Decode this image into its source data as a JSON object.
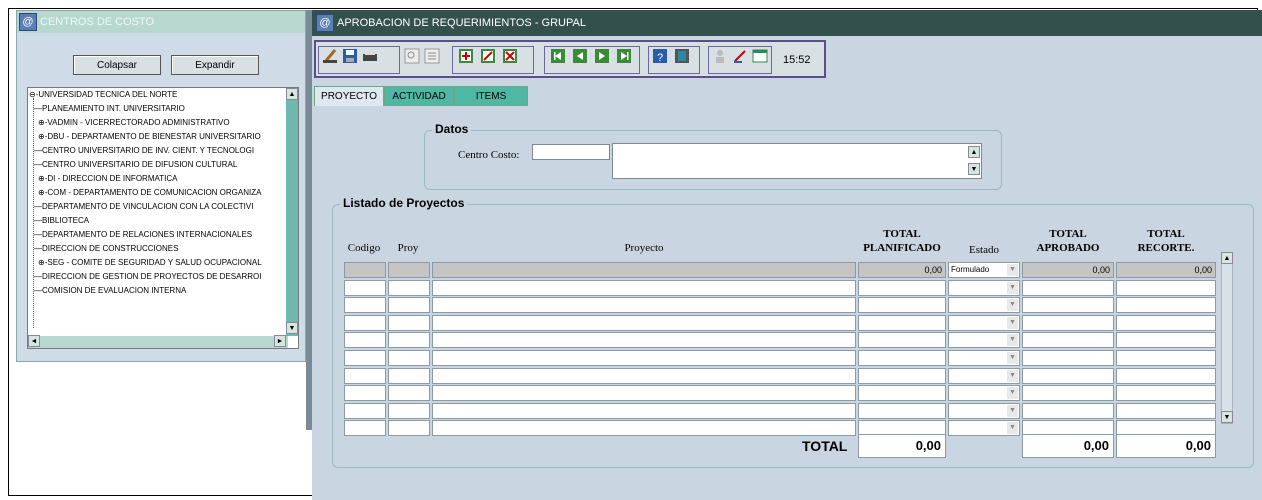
{
  "left_window": {
    "title": "CENTROS DE COSTO",
    "collapse_label": "Colapsar",
    "expand_label": "Expandir",
    "tree": [
      {
        "label": "UNIVERSIDAD TECNICA DEL NORTE",
        "prefix": "⊖-"
      },
      {
        "label": "PLANEAMIENTO INT. UNIVERSITARIO",
        "prefix": ""
      },
      {
        "label": "VADMIN - VICERRECTORADO ADMINISTRATIVO",
        "prefix": "⊕-"
      },
      {
        "label": "DBU - DEPARTAMENTO DE BIENESTAR UNIVERSITARIO",
        "prefix": "⊕-"
      },
      {
        "label": "CENTRO UNIVERSITARIO DE INV. CIENT. Y TECNOLOGI",
        "prefix": ""
      },
      {
        "label": "CENTRO UNIVERSITARIO DE DIFUSION CULTURAL",
        "prefix": ""
      },
      {
        "label": "DI - DIRECCION DE INFORMATICA",
        "prefix": "⊕-"
      },
      {
        "label": "COM - DEPARTAMENTO DE COMUNICACION ORGANIZA",
        "prefix": "⊕-"
      },
      {
        "label": "DEPARTAMENTO DE VINCULACION CON LA COLECTIVI",
        "prefix": ""
      },
      {
        "label": "BIBLIOTECA",
        "prefix": ""
      },
      {
        "label": "DEPARTAMENTO DE RELACIONES INTERNACIONALES",
        "prefix": ""
      },
      {
        "label": "DIRECCION DE CONSTRUCCIONES",
        "prefix": ""
      },
      {
        "label": "SEG - COMITE DE SEGURIDAD Y SALUD OCUPACIONAL",
        "prefix": "⊕-"
      },
      {
        "label": "DIRECCION DE GESTION DE PROYECTOS DE DESARROI",
        "prefix": ""
      },
      {
        "label": "COMISION DE EVALUACION INTERNA",
        "prefix": ""
      }
    ]
  },
  "right_window": {
    "title": "APROBACION DE REQUERIMIENTOS - GRUPAL",
    "clock": "15:52",
    "tabs": [
      "PROYECTO",
      "ACTIVIDAD",
      "ITEMS"
    ],
    "datos": {
      "legend": "Datos",
      "centro_costo_label": "Centro Costo:"
    },
    "listado": {
      "legend": "Listado de Proyectos",
      "headers": {
        "codigo": "Codigo",
        "proy": "Proy",
        "proyecto": "Proyecto",
        "total_planificado_1": "TOTAL",
        "total_planificado_2": "PLANIFICADO",
        "estado": "Estado",
        "total_aprobado_1": "TOTAL",
        "total_aprobado_2": "APROBADO",
        "total_recorte_1": "TOTAL",
        "total_recorte_2": "RECORTE."
      },
      "first_row": {
        "planificado": "0,00",
        "estado": "Formulado",
        "aprobado": "0,00",
        "recorte": "0,00"
      },
      "total_label": "TOTAL",
      "totals": {
        "planificado": "0,00",
        "aprobado": "0,00",
        "recorte": "0,00"
      }
    }
  }
}
